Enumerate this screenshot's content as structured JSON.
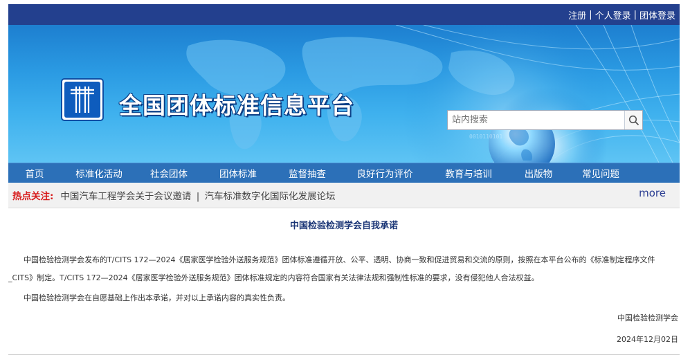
{
  "topbar": {
    "links": [
      "注册",
      "个人登录",
      "团体登录"
    ]
  },
  "header": {
    "site_title": "全国团体标准信息平台",
    "search_placeholder": "站内搜索",
    "search_icon": "search-icon"
  },
  "nav": {
    "items": [
      "首页",
      "标准化活动",
      "社会团体",
      "团体标准",
      "监督抽查",
      "良好行为评价",
      "教育与培训",
      "出版物",
      "常见问题"
    ]
  },
  "hot": {
    "label": "热点关注:",
    "news": [
      "中国汽车工程学会关于会议邀请",
      "汽车标准数字化国际化发展论坛"
    ],
    "separator": "|",
    "more": "more"
  },
  "article": {
    "title": "中国检验检测学会自我承诺",
    "paragraph1": "中国检验检测学会发布的T/CITS 172—2024《居家医学检验外送服务规范》团体标准遵循开放、公平、透明、协商一致和促进贸易和交流的原则，按照在本平台公布的《标准制定程序文件_CITS》制定。T/CITS 172—2024《居家医学检验外送服务规范》团体标准规定的内容符合国家有关法律法规和强制性标准的要求，没有侵犯他人合法权益。",
    "paragraph2": "中国检验检测学会在自愿基础上作出本承诺，并对以上承诺内容的真实性负责。",
    "signature": "中国检验检测学会",
    "date": "2024年12月02日"
  },
  "colors": {
    "topbar": "#23408e",
    "nav": "#2c70b8",
    "hot_label": "#d71b1b",
    "title": "#1a3576"
  }
}
